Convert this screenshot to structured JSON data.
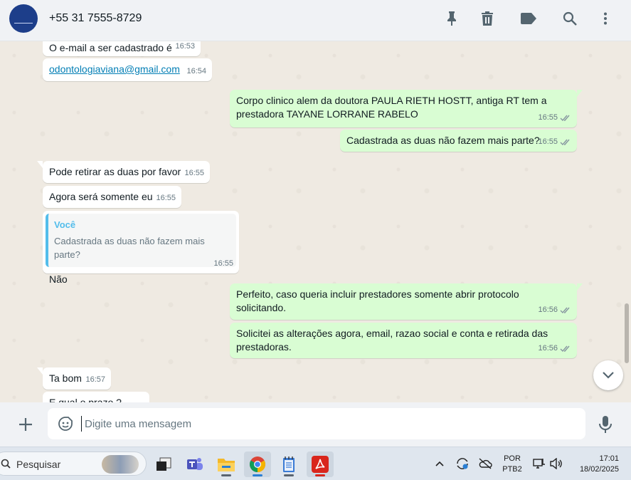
{
  "header": {
    "contact_name": "+55 31 7555-8729",
    "icons": [
      "pin-icon",
      "delete-icon",
      "label-icon",
      "search-icon",
      "more-vertical-icon"
    ]
  },
  "messages": [
    {
      "dir": "in",
      "text": "O e-mail a ser cadastrado é",
      "time": "16:53"
    },
    {
      "dir": "in",
      "text": "odontologiaviana@gmail.com",
      "time": "16:54",
      "is_link": true
    },
    {
      "dir": "out",
      "text": "Corpo clinico alem da doutora PAULA RIETH HOSTT, antiga RT tem a prestadora TAYANE LORRANE RABELO",
      "time": "16:55",
      "read": true
    },
    {
      "dir": "out",
      "text": "Cadastrada as duas não fazem mais parte?",
      "time": "16:55",
      "read": true
    },
    {
      "dir": "in",
      "text": "Pode retirar as duas por favor",
      "time": "16:55"
    },
    {
      "dir": "in",
      "text": "Agora será somente eu",
      "time": "16:55"
    },
    {
      "dir": "in",
      "text": "Não",
      "time": "16:55",
      "quote": {
        "author": "Você",
        "text": "Cadastrada as duas não fazem mais parte?"
      }
    },
    {
      "dir": "out",
      "text": "Perfeito, caso queria incluir prestadores somente abrir protocolo solicitando.",
      "time": "16:56",
      "read": true
    },
    {
      "dir": "out",
      "text": "Solicitei as alterações agora, email, razao social e conta e retirada das prestadoras.",
      "time": "16:56",
      "read": true
    },
    {
      "dir": "in",
      "text": "Ta bom",
      "time": "16:57"
    },
    {
      "dir": "in",
      "text": "E qual o prazo ?",
      "time": ""
    }
  ],
  "composer": {
    "placeholder": "Digite uma mensagem",
    "value": ""
  },
  "taskbar": {
    "search_label": "Pesquisar",
    "lang_line1": "POR",
    "lang_line2": "PTB2",
    "time": "17:01",
    "date": "18/02/2025"
  },
  "colors": {
    "incoming_bubble": "#ffffff",
    "outgoing_bubble": "#d9fdd3",
    "chat_background": "#efeae2",
    "header_background": "#f0f2f5",
    "quote_accent": "#53bdeb"
  }
}
